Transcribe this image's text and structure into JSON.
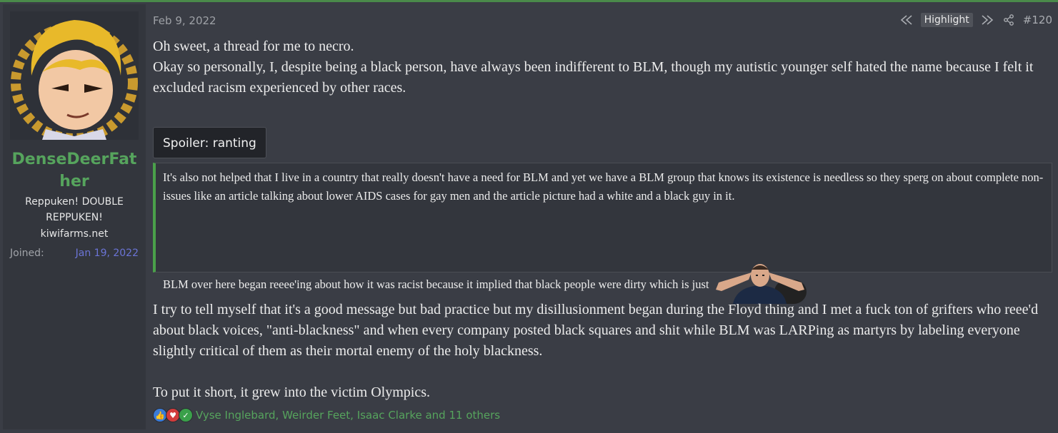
{
  "user": {
    "name": "DenseDeerFather",
    "title": "Reppuken! DOUBLE REPPUKEN!",
    "site": "kiwifarms.net",
    "joined_label": "Joined:",
    "joined_value": "Jan 19, 2022",
    "avatar_icon": "avatar-icon"
  },
  "post": {
    "date": "Feb 9, 2022",
    "highlight_label": "Highlight",
    "number": "#120",
    "para1_line1": "Oh sweet, a thread for me to necro.",
    "para1_line2": "Okay so personally, I, despite being a black person, have always been indifferent to BLM, though my autistic younger self hated the name because I felt it excluded racism experienced by other races.",
    "spoiler_label": "Spoiler: ranting",
    "spoiler_p1": "It's also not helped that I live in a country that really doesn't have a need for BLM and yet we have a BLM group that knows its existence is needless so they sperg on about complete non-issues like an article talking about lower AIDS cases for gay men and the article picture had a white and a black guy in it.",
    "spoiler_p2": "BLM over here began reeee'ing about how it was racist because it implied that black people were dirty which is just",
    "para2": "I try to tell myself that it's a good message but bad practice but my disillusionment began during the Floyd thing and I met a fuck ton of grifters who reee'd about black voices, \"anti-blackness\" and when every company posted black squares and shit while BLM was LARPing as martyrs by labeling everyone slightly critical of them as their mortal enemy of the holy blackness.",
    "para3": "To put it short, it grew into the victim Olympics.",
    "reactions_text": "Vyse Inglebard, Weirder Feet, Isaac Clarke and 11 others"
  },
  "colors": {
    "accent_green": "#56a45d",
    "joined_blue": "#6b74d6",
    "background": "#3a3d45"
  },
  "icons": [
    "prev-post-icon",
    "next-post-icon",
    "share-icon",
    "like-icon",
    "love-icon",
    "check-icon"
  ]
}
